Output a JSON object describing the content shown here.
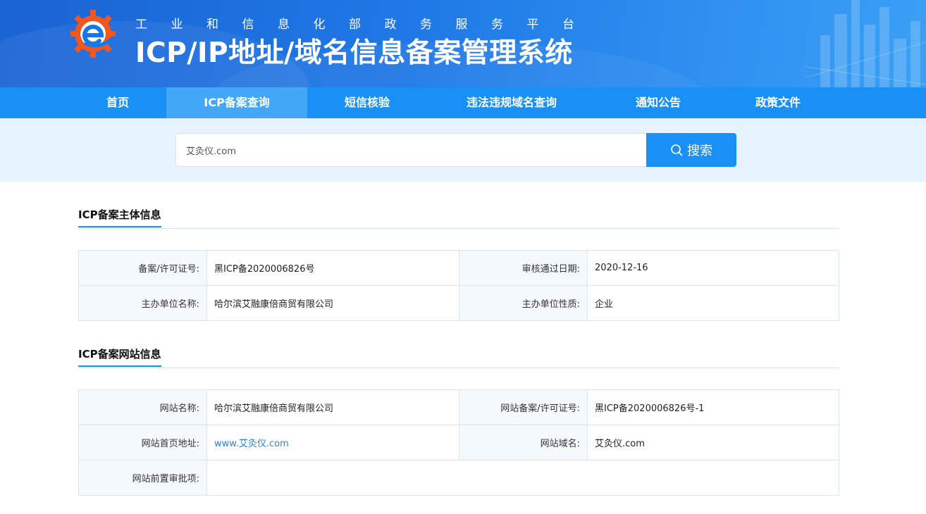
{
  "header": {
    "subtitle": "工业和信息化部政务服务平台",
    "title": "ICP/IP地址/域名信息备案管理系统"
  },
  "nav": {
    "items": [
      "首页",
      "ICP备案查询",
      "短信核验",
      "违法违规域名查询",
      "通知公告",
      "政策文件"
    ],
    "active_index": 1
  },
  "search": {
    "value": "艾灸仪.com",
    "button_label": "搜索"
  },
  "subject_section": {
    "title": "ICP备案主体信息",
    "license_label": "备案/许可证号:",
    "license_value": "黑ICP备2020006826号",
    "approve_date_label": "审核通过日期:",
    "approve_date_value": "2020-12-16",
    "org_name_label": "主办单位名称:",
    "org_name_value": "哈尔滨艾融康倍商贸有限公司",
    "org_type_label": "主办单位性质:",
    "org_type_value": "企业"
  },
  "website_section": {
    "title": "ICP备案网站信息",
    "site_name_label": "网站名称:",
    "site_name_value": "哈尔滨艾融康倍商贸有限公司",
    "site_license_label": "网站备案/许可证号:",
    "site_license_value": "黑ICP备2020006826号-1",
    "homepage_label": "网站首页地址:",
    "homepage_value": "www.艾灸仪.com",
    "domain_label": "网站域名:",
    "domain_value": "艾灸仪.com",
    "preapproval_label": "网站前置审批项:",
    "preapproval_value": ""
  },
  "colors": {
    "primary": "#1890f5",
    "nav_active": "#43a7f7",
    "search_band": "#e6f3fd",
    "label_bg": "#f4f9fd",
    "border": "#d4e5f4",
    "link": "#2b7fdc",
    "logo_orange": "#f0561d",
    "logo_blue": "#1877e6"
  },
  "icons": {
    "logo": "gear-e-logo",
    "search": "search-icon"
  }
}
